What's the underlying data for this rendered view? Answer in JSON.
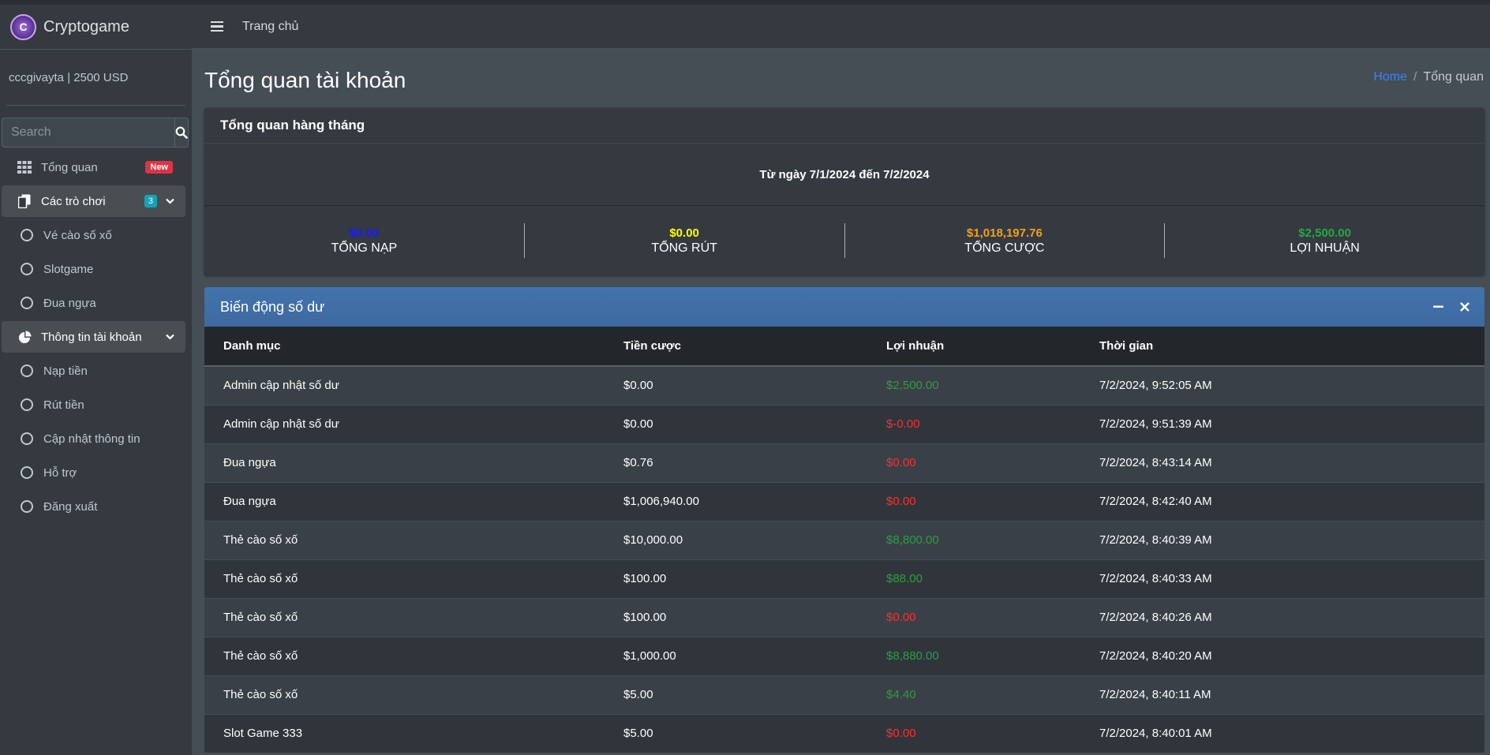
{
  "brand": {
    "name": "Cryptogame",
    "logo_text": "C"
  },
  "user": {
    "info": "cccgivayta | 2500 USD"
  },
  "search": {
    "placeholder": "Search"
  },
  "sidebar": {
    "items": [
      {
        "label": "Tổng quan",
        "badge": "New"
      },
      {
        "label": "Các trò chơi",
        "badge": "3"
      },
      {
        "label": "Vé cào số xố"
      },
      {
        "label": "Slotgame"
      },
      {
        "label": "Đua ngựa"
      },
      {
        "label": "Thông tin tài khoản"
      },
      {
        "label": "Nạp tiền"
      },
      {
        "label": "Rút tiền"
      },
      {
        "label": "Cập nhật thông tin"
      },
      {
        "label": "Hỗ trợ"
      },
      {
        "label": "Đăng xuất"
      }
    ]
  },
  "topnav": {
    "home_link": "Trang chủ"
  },
  "page": {
    "title": "Tổng quan tài khoản",
    "breadcrumb": {
      "home": "Home",
      "separator": "/",
      "current": "Tổng quan"
    }
  },
  "monthly": {
    "title": "Tổng quan hàng tháng",
    "period": "Từ ngày 7/1/2024 đến 7/2/2024",
    "stats": [
      {
        "value": "$0.00",
        "label": "TỔNG NẠP",
        "color": "#1a1aff"
      },
      {
        "value": "$0.00",
        "label": "TỔNG RÚT",
        "color": "#ffff00"
      },
      {
        "value": "$1,018,197.76",
        "label": "TỔNG CƯỢC",
        "color": "#f0a020"
      },
      {
        "value": "$2,500.00",
        "label": "LỢI NHUẬN",
        "color": "#28a745"
      }
    ]
  },
  "balance": {
    "title": "Biến động số dư",
    "columns": [
      "Danh mục",
      "Tiền cược",
      "Lợi nhuận",
      "Thời gian"
    ],
    "rows": [
      {
        "category": "Admin cập nhật số dư",
        "bet": "$0.00",
        "profit": "$2,500.00",
        "profit_color": "green",
        "time": "7/2/2024, 9:52:05 AM"
      },
      {
        "category": "Admin cập nhật số dư",
        "bet": "$0.00",
        "profit": "$-0.00",
        "profit_color": "red",
        "time": "7/2/2024, 9:51:39 AM"
      },
      {
        "category": "Đua ngựa",
        "bet": "$0.76",
        "profit": "$0.00",
        "profit_color": "red",
        "time": "7/2/2024, 8:43:14 AM"
      },
      {
        "category": "Đua ngựa",
        "bet": "$1,006,940.00",
        "profit": "$0.00",
        "profit_color": "red",
        "time": "7/2/2024, 8:42:40 AM"
      },
      {
        "category": "Thẻ cào số xố",
        "bet": "$10,000.00",
        "profit": "$8,800.00",
        "profit_color": "green",
        "time": "7/2/2024, 8:40:39 AM"
      },
      {
        "category": "Thẻ cào số xố",
        "bet": "$100.00",
        "profit": "$88.00",
        "profit_color": "green",
        "time": "7/2/2024, 8:40:33 AM"
      },
      {
        "category": "Thẻ cào số xố",
        "bet": "$100.00",
        "profit": "$0.00",
        "profit_color": "red",
        "time": "7/2/2024, 8:40:26 AM"
      },
      {
        "category": "Thẻ cào số xố",
        "bet": "$1,000.00",
        "profit": "$8,880.00",
        "profit_color": "green",
        "time": "7/2/2024, 8:40:20 AM"
      },
      {
        "category": "Thẻ cào số xố",
        "bet": "$5.00",
        "profit": "$4.40",
        "profit_color": "green",
        "time": "7/2/2024, 8:40:11 AM"
      },
      {
        "category": "Slot Game 333",
        "bet": "$5.00",
        "profit": "$0.00",
        "profit_color": "red",
        "time": "7/2/2024, 8:40:01 AM"
      }
    ]
  },
  "icons": {
    "search": "search-icon",
    "dashboard": "grid-icon",
    "games": "copy-icon",
    "account": "pie-chart-icon",
    "menu": "hamburger-icon",
    "minimize": "minus-icon",
    "close": "close-icon"
  }
}
